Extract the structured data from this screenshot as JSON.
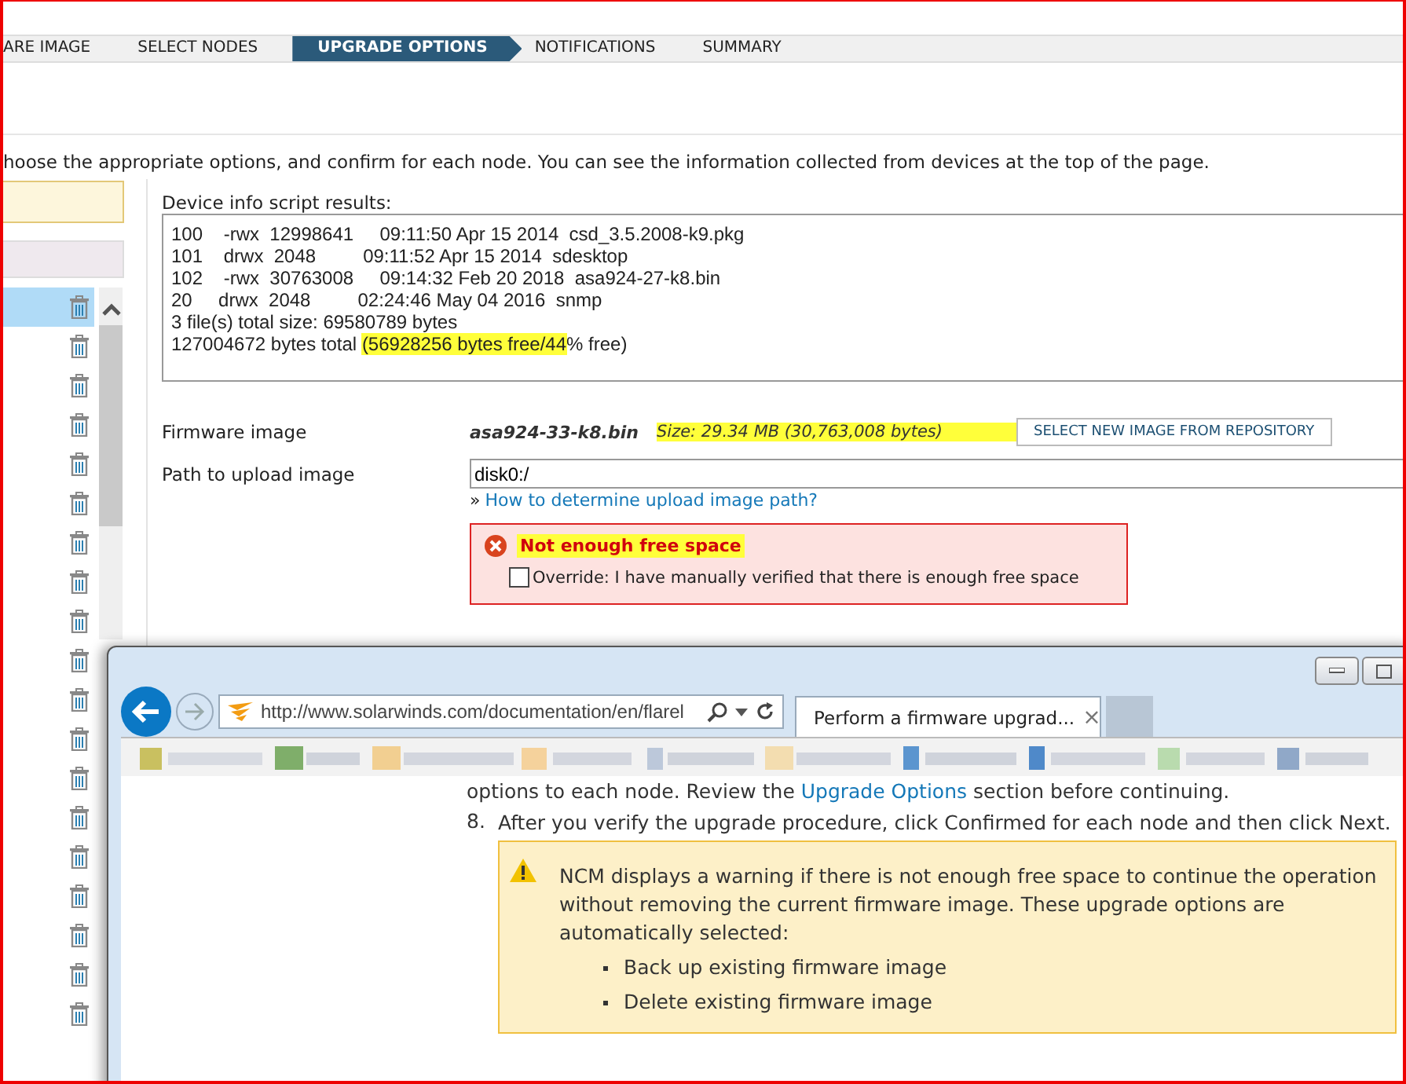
{
  "wizard_steps": [
    {
      "label": "ARE IMAGE",
      "selected": false
    },
    {
      "label": "SELECT NODES",
      "selected": false
    },
    {
      "label": "UPGRADE OPTIONS",
      "selected": true
    },
    {
      "label": "NOTIFICATIONS",
      "selected": false
    },
    {
      "label": "SUMMARY",
      "selected": false
    }
  ],
  "instruction": "hoose the appropriate options, and confirm for each node. You can see the information collected from devices at the top of the page.",
  "node_list": {
    "rows": [
      {
        "selected": true
      },
      {
        "selected": false
      },
      {
        "selected": false
      },
      {
        "selected": false
      },
      {
        "selected": false
      },
      {
        "selected": false
      },
      {
        "selected": false
      },
      {
        "selected": false
      },
      {
        "selected": false
      },
      {
        "selected": false
      },
      {
        "selected": false
      },
      {
        "selected": false
      },
      {
        "selected": false
      },
      {
        "selected": false
      },
      {
        "selected": false
      },
      {
        "selected": false
      },
      {
        "selected": false
      },
      {
        "selected": false
      },
      {
        "selected": false
      }
    ]
  },
  "device_info": {
    "label": "Device info script results:",
    "lines": [
      [
        {
          "text": "100    -rwx  12998641     09:11:50 Apr 15 2014  csd_3.5.2008-k9.pkg",
          "highlighted": false
        }
      ],
      [
        {
          "text": "101    drwx  2048         09:11:52 Apr 15 2014  sdesktop",
          "highlighted": false
        }
      ],
      [
        {
          "text": "102    -rwx  30763008     09:14:32 Feb 20 2018  asa924-27-k8.bin",
          "highlighted": false
        }
      ],
      [
        {
          "text": "20     drwx  2048         02:24:46 May 04 2016  snmp",
          "highlighted": false
        }
      ],
      [
        {
          "text": "3 file(s) total size: 69580789 bytes",
          "highlighted": false
        }
      ],
      [
        {
          "text": "127004672 bytes total ",
          "highlighted": false
        },
        {
          "text": "(56928256 bytes free/44",
          "highlighted": true
        },
        {
          "text": "% free)",
          "highlighted": false
        }
      ]
    ]
  },
  "firmware": {
    "label": "Firmware image",
    "file": "asa924-33-k8.bin",
    "size": "Size: 29.34 MB (30,763,008 bytes)",
    "size_highlighted": true,
    "button": "SELECT NEW IMAGE FROM REPOSITORY"
  },
  "upload_path": {
    "label": "Path to upload image",
    "value": "disk0:/",
    "link_prefix": "»",
    "link": "How to determine upload image path?"
  },
  "error": {
    "message": "Not enough free space",
    "highlighted": true,
    "override_checked": false,
    "override_label": "Override: I have manually verified that there is enough free space"
  },
  "browser": {
    "address": "http://www.solarwinds.com/documentation/en/flarel",
    "tab": "Perform a firmware upgrad...",
    "tab_close": "×",
    "lead_parts": [
      "options to each node. Review the ",
      "Upgrade Options",
      " section before continuing."
    ],
    "step_number": "8.",
    "step_text": "After you verify the upgrade procedure, click Confirmed for each node and then click Next.",
    "warning": {
      "text": "NCM displays a warning if there is not enough free space to continue the operation without removing the current firmware image. These upgrade options are automatically selected:",
      "bullets": [
        "Back up existing firmware image",
        "Delete existing firmware image"
      ]
    }
  }
}
